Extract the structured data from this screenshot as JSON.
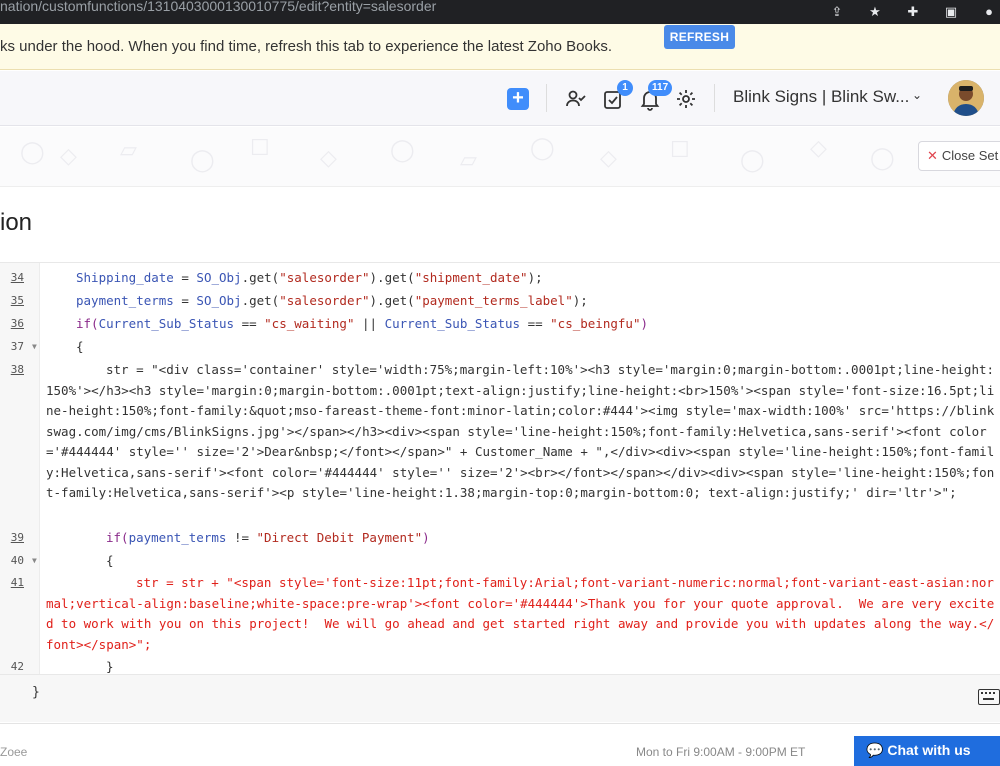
{
  "browser": {
    "url": "nation/customfunctions/1310403000130010775/edit?entity=salesorder"
  },
  "banner": {
    "message": "ks under the hood. When you find time, refresh this tab to experience the latest Zoho Books.",
    "refresh_label": "REFRESH"
  },
  "topnav": {
    "plus_label": "+",
    "tasks_badge": "1",
    "notifications_badge": "117",
    "org_name": "Blink Signs | Blink Sw...",
    "accent": "#408dfb"
  },
  "close_button": {
    "label": "Close Set"
  },
  "page": {
    "title": "ion"
  },
  "editor": {
    "lines": [
      {
        "num": "34",
        "underlined": true,
        "fold": ""
      },
      {
        "num": "35",
        "underlined": true,
        "fold": ""
      },
      {
        "num": "36",
        "underlined": true,
        "fold": ""
      },
      {
        "num": "37",
        "underlined": false,
        "fold": "▼"
      },
      {
        "num": "38",
        "underlined": true,
        "fold": ""
      },
      {
        "num": "39",
        "underlined": true,
        "fold": ""
      },
      {
        "num": "40",
        "underlined": false,
        "fold": "▼"
      },
      {
        "num": "41",
        "underlined": true,
        "fold": ""
      },
      {
        "num": "42",
        "underlined": false,
        "fold": ""
      }
    ],
    "code": {
      "l34_var": "Shipping_date",
      "l34_eq": " = ",
      "l34_obj": "SO_Obj",
      "l34_get1": ".get(",
      "l34_s1": "\"salesorder\"",
      "l34_get2": ").get(",
      "l34_s2": "\"shipment_date\"",
      "l34_end": ");",
      "l35_var": "payment_terms",
      "l35_eq": " = ",
      "l35_obj": "SO_Obj",
      "l35_get1": ".get(",
      "l35_s1": "\"salesorder\"",
      "l35_get2": ").get(",
      "l35_s2": "\"payment_terms_label\"",
      "l35_end": ");",
      "l36_if": "if(",
      "l36_v1": "Current_Sub_Status",
      "l36_op1": " == ",
      "l36_s1": "\"cs_waiting\"",
      "l36_or": " || ",
      "l36_v2": "Current_Sub_Status",
      "l36_op2": " == ",
      "l36_s2": "\"cs_beingfu\"",
      "l36_end": ")",
      "l37": "{",
      "l38_text": "str = \"<div class='container' style='width:75%;margin-left:10%'><h3 style='margin:0;margin-bottom:.0001pt;line-height:150%'></h3><h3 style='margin:0;margin-bottom:.0001pt;text-align:justify;line-height:<br>150%'><span style='font-size:16.5pt;line-height:150%;font-family:&quot;mso-fareast-theme-font:minor-latin;color:#444'><img style='max-width:100%' src='https://blinkswag.com/img/cms/BlinkSigns.jpg'></span></h3><div><span style='line-height:150%;font-family:Helvetica,sans-serif'><font color='#444444' style='' size='2'>Dear&nbsp;</font></span>\" + Customer_Name + \",</div><div><span style='line-height:150%;font-family:Helvetica,sans-serif'><font color='#444444' style='' size='2'><br></font></span></div><div><span style='line-height:150%;font-family:Helvetica,sans-serif'><p style='line-height:1.38;margin-top:0;margin-bottom:0; text-align:justify;' dir='ltr'>\";",
      "l39_if": "if(",
      "l39_var": "payment_terms",
      "l39_op": " != ",
      "l39_s": "\"Direct Debit Payment\"",
      "l39_end": ")",
      "l40": "{",
      "l41_text": "str = str + \"<span style='font-size:11pt;font-family:Arial;font-variant-numeric:normal;font-variant-east-asian:normal;vertical-align:baseline;white-space:pre-wrap'><font color='#444444'>Thank you for your quote approval.  We are very excited to work with you on this project!  We will go ahead and get started right away and provide you with updates along the way.</font></span>\";",
      "l42": "}",
      "bottom_brace": "}"
    }
  },
  "footer": {
    "left_text": "Zoee",
    "hours": "Mon to Fri 9:00AM - 9:00PM ET",
    "chat_label": "Chat with us"
  }
}
